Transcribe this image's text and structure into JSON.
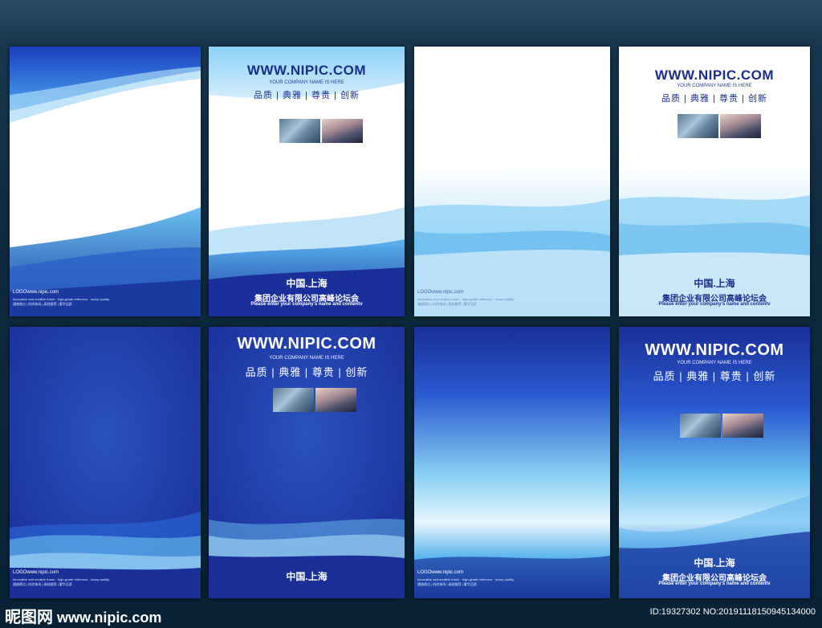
{
  "url": "WWW.NIPIC.COM",
  "tagline": "YOUR COMPANY NAME IS HERE",
  "slogan": "品质 | 典雅 | 尊贵 | 创新",
  "city": "中国.上海",
  "company": "集团企业有限公司高峰论坛会",
  "enter": "Please enter your company's name and contentv",
  "logo": "LOGOwww.nipic.com",
  "tiny1": "Innovative and creative future  ·  high-grade reference  ·  luxury quality",
  "tiny2": "通旅视点 | 时尚休闲 | 高档推荐 | 奢华品质",
  "footer": {
    "brand": "昵图网",
    "site": "www.nipic.com",
    "id": "ID:19327302 NO:20191118150945134000"
  }
}
